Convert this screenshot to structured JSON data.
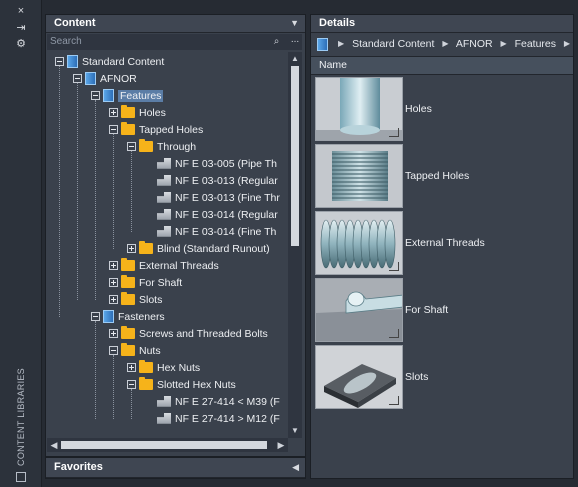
{
  "sidebar": {
    "close_glyph": "×",
    "pin_glyph": "⇥",
    "settings_glyph": "⚙",
    "vertical_label": "CONTENT LIBRARIES",
    "bottom_icon": "library-icon"
  },
  "content": {
    "title": "Content",
    "search_placeholder": "Search",
    "more_glyph": "...",
    "tree": [
      {
        "label": "Standard Content",
        "icon": "library-icon",
        "expander": "minus"
      },
      {
        "label": "AFNOR",
        "icon": "library-icon",
        "expander": "minus"
      },
      {
        "label": "Features",
        "icon": "category-icon",
        "expander": "minus",
        "selected": true
      },
      {
        "label": "Holes",
        "icon": "folder-icon",
        "expander": "plus"
      },
      {
        "label": "Tapped Holes",
        "icon": "folder-icon",
        "expander": "minus"
      },
      {
        "label": "Through",
        "icon": "folder-icon",
        "expander": "minus"
      },
      {
        "label": "NF E 03-005  (Pipe Th",
        "icon": "part-icon"
      },
      {
        "label": "NF E 03-013  (Regular",
        "icon": "part-icon"
      },
      {
        "label": "NF E 03-013  (Fine Thr",
        "icon": "part-icon"
      },
      {
        "label": "NF E 03-014  (Regular",
        "icon": "part-icon"
      },
      {
        "label": "NF E 03-014  (Fine Th",
        "icon": "part-icon"
      },
      {
        "label": "Blind (Standard Runout)",
        "icon": "folder-icon",
        "expander": "plus"
      },
      {
        "label": "External Threads",
        "icon": "folder-icon",
        "expander": "plus"
      },
      {
        "label": "For Shaft",
        "icon": "folder-icon",
        "expander": "plus"
      },
      {
        "label": "Slots",
        "icon": "folder-icon",
        "expander": "plus"
      },
      {
        "label": "Fasteners",
        "icon": "category-icon",
        "expander": "minus"
      },
      {
        "label": "Screws and Threaded Bolts",
        "icon": "folder-icon",
        "expander": "plus"
      },
      {
        "label": "Nuts",
        "icon": "folder-icon",
        "expander": "minus"
      },
      {
        "label": "Hex Nuts",
        "icon": "folder-icon",
        "expander": "plus"
      },
      {
        "label": "Slotted Hex Nuts",
        "icon": "folder-icon",
        "expander": "minus"
      },
      {
        "label": "NF E 27-414 < M39  (F",
        "icon": "part-icon"
      },
      {
        "label": "NF E 27-414 > M12  (F",
        "icon": "part-icon"
      }
    ]
  },
  "favorites": {
    "title": "Favorites"
  },
  "details": {
    "title": "Details",
    "breadcrumb": [
      "Standard Content",
      "AFNOR",
      "Features"
    ],
    "column_header": "Name",
    "items": [
      {
        "name": "Holes",
        "thumbnail": "holes-thumbnail"
      },
      {
        "name": "Tapped Holes",
        "thumbnail": "tapped-holes-thumbnail"
      },
      {
        "name": "External Threads",
        "thumbnail": "external-threads-thumbnail"
      },
      {
        "name": "For Shaft",
        "thumbnail": "for-shaft-thumbnail"
      },
      {
        "name": "Slots",
        "thumbnail": "slots-thumbnail"
      }
    ]
  },
  "colors": {
    "panel_bg": "#3a414c",
    "header_bg": "#3f4652",
    "folder": "#f6b31a",
    "selection": "#5b7da6",
    "accent_blue": "#2d6fb8"
  }
}
